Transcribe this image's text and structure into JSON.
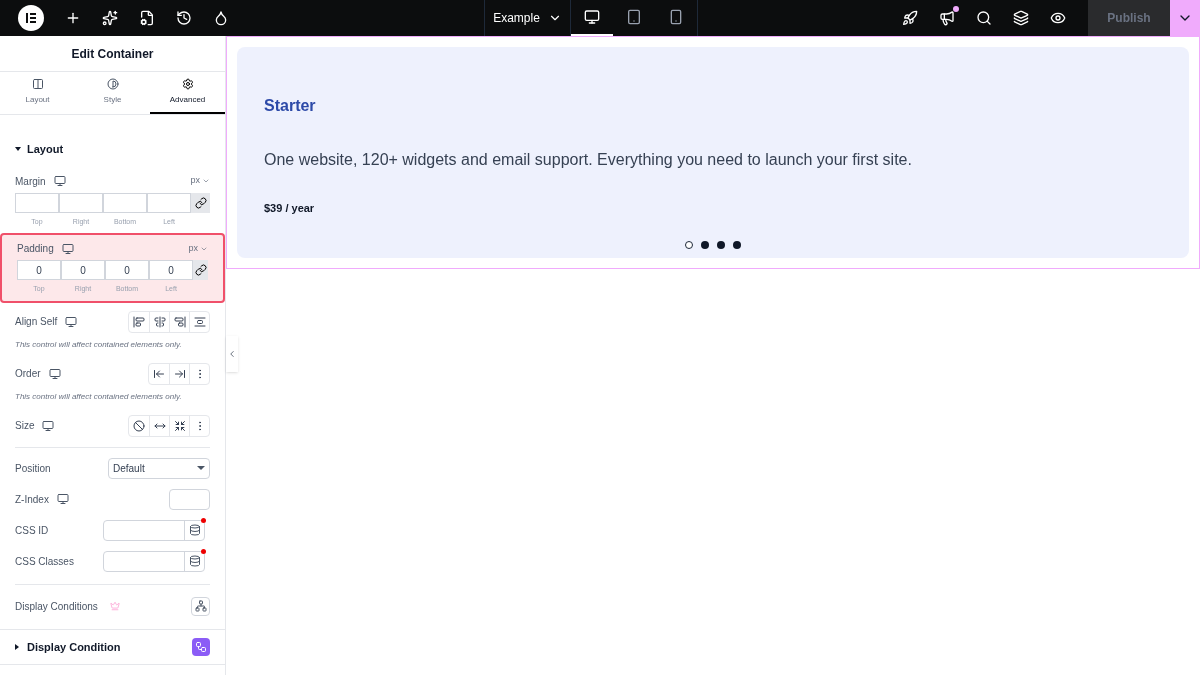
{
  "topbar": {
    "page_title": "Example",
    "devices": [
      {
        "kind": "desktop",
        "selected": true
      },
      {
        "kind": "tablet",
        "selected": false
      },
      {
        "kind": "mobile",
        "selected": false
      }
    ],
    "notification": true,
    "publish": {
      "label": "Publish",
      "disabled": true
    }
  },
  "panel": {
    "title": "Edit Container",
    "tabs": [
      {
        "kind": "layout",
        "label": "Layout",
        "selected": false
      },
      {
        "kind": "style",
        "label": "Style",
        "selected": false
      },
      {
        "kind": "advanced",
        "label": "Advanced",
        "selected": true
      }
    ],
    "section": {
      "title": "Layout",
      "expanded": true
    },
    "spacing": [
      {
        "label": "Margin",
        "unit": "px",
        "sides": [
          "Top",
          "Right",
          "Bottom",
          "Left"
        ],
        "highlighted": false
      },
      {
        "label": "Padding",
        "unit": "px",
        "values": [
          "0",
          "0",
          "0",
          "0"
        ],
        "sides": [
          "Top",
          "Right",
          "Bottom",
          "Left"
        ],
        "highlighted": true
      }
    ],
    "controls": [
      {
        "kind": "align",
        "label": "Align Self",
        "note": "This control will affect contained elements only."
      },
      {
        "kind": "order",
        "label": "Order",
        "note": "This control will affect contained elements only."
      },
      {
        "kind": "size",
        "label": "Size"
      },
      {
        "kind": "select",
        "label": "Position",
        "value": "Default"
      },
      {
        "kind": "zindex",
        "label": "Z-Index"
      },
      {
        "kind": "dynamic",
        "label": "CSS ID"
      },
      {
        "kind": "dynamic",
        "label": "CSS Classes"
      },
      {
        "kind": "conditions",
        "label": "Display Conditions"
      }
    ],
    "collapsed_section": {
      "title": "Display Condition",
      "expanded": false
    }
  },
  "canvas": {
    "card": {
      "title": "Starter",
      "description": "One website, 120+ widgets and email support. Everything you need to launch your first site.",
      "price": "$39 / year"
    },
    "dots": [
      {
        "selected": true
      },
      {
        "selected": false
      },
      {
        "selected": false
      },
      {
        "selected": false
      }
    ]
  }
}
